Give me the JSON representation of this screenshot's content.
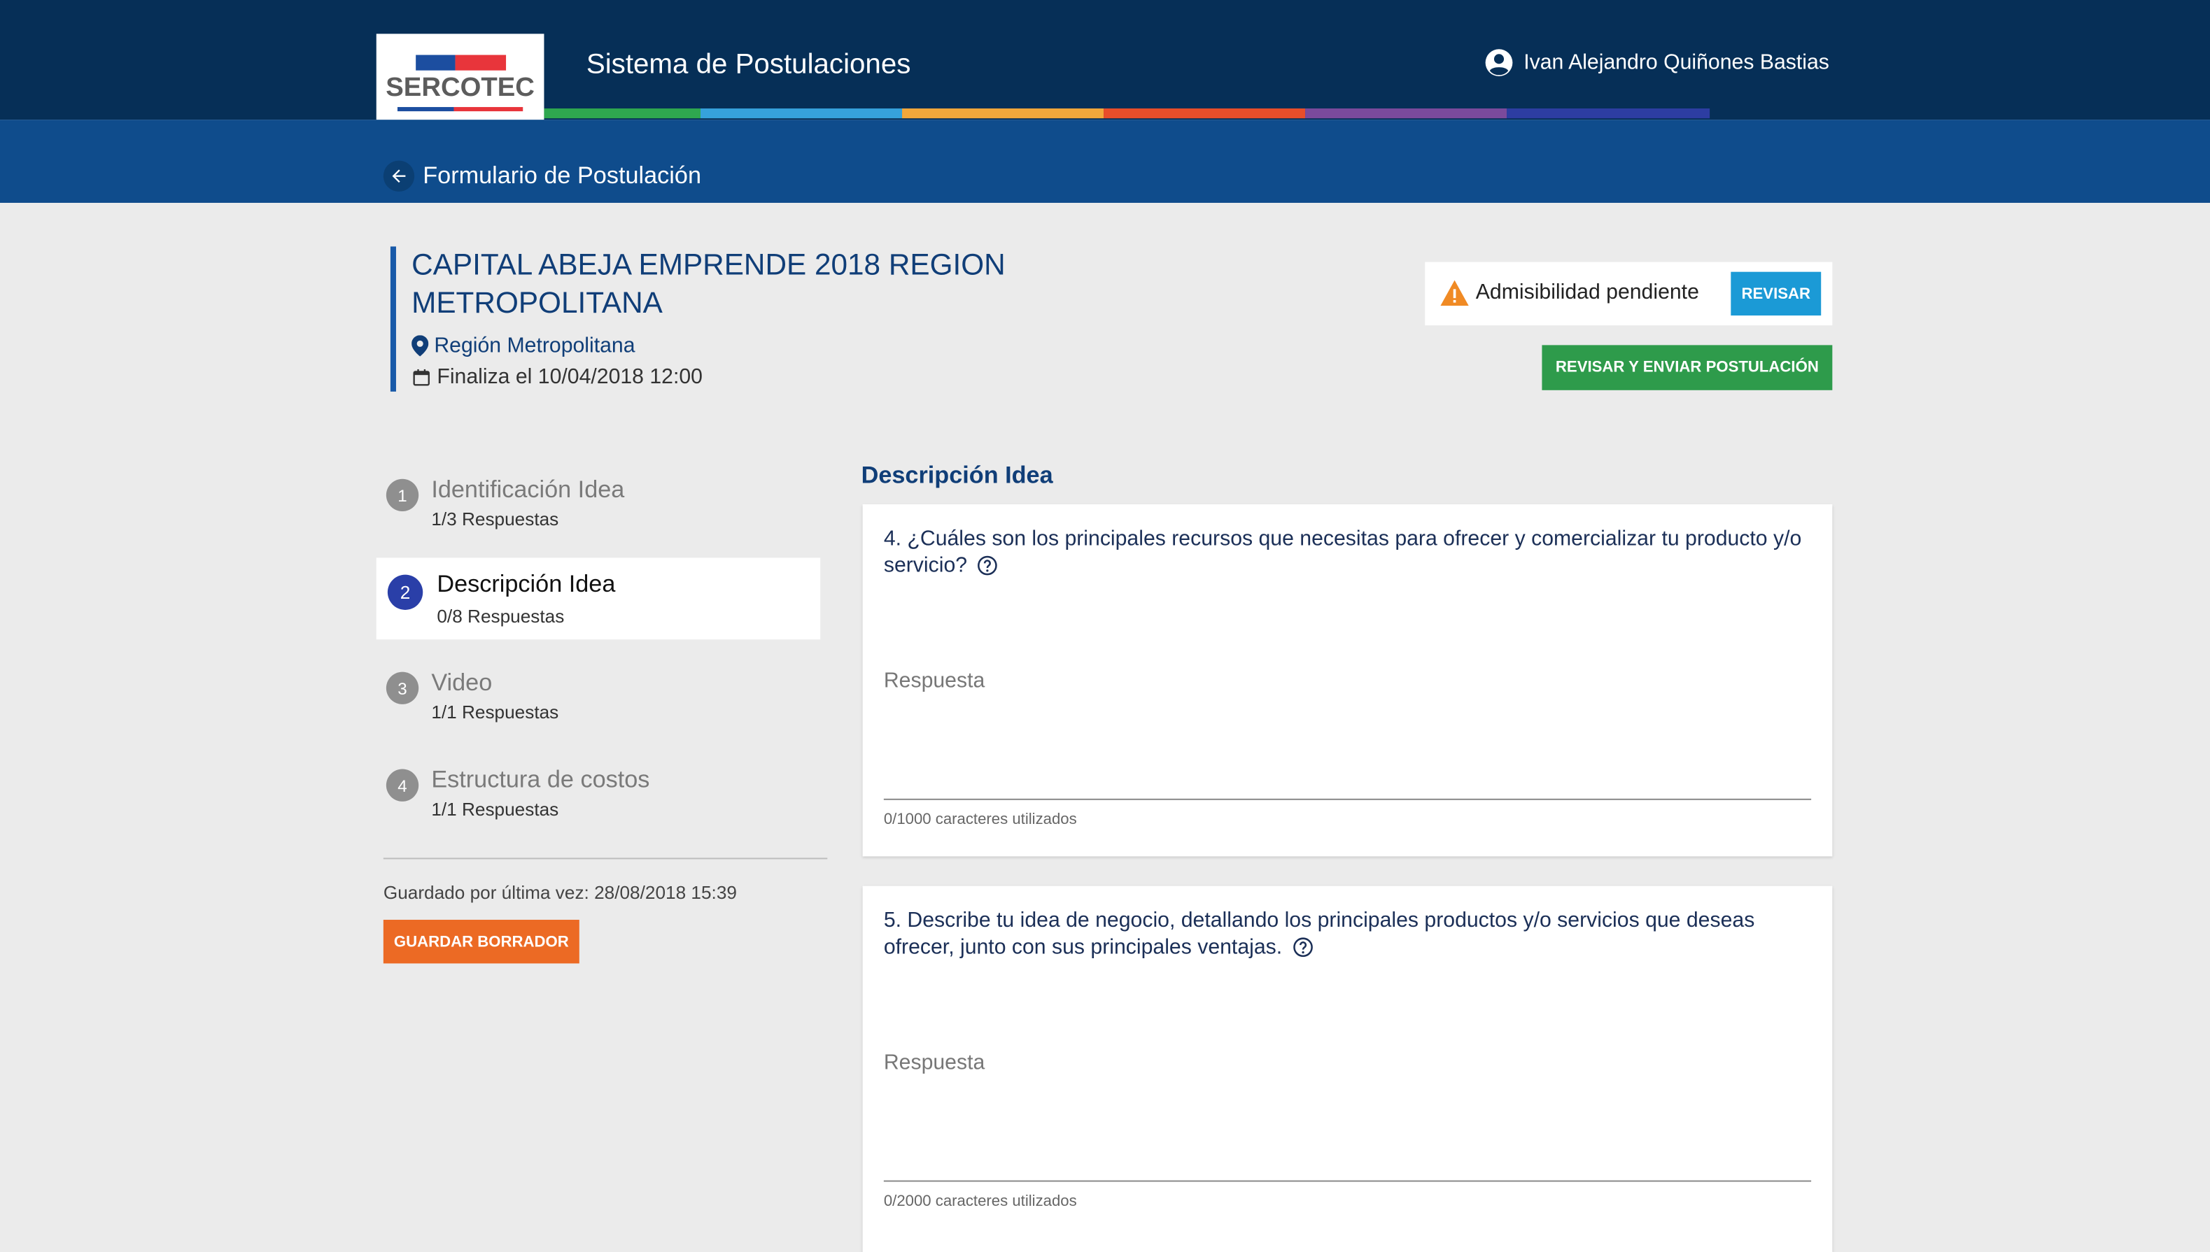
{
  "header": {
    "logo_text": "SERCOTEC",
    "app_title": "Sistema de Postulaciones",
    "user_name": "Ivan Alejandro Quiñones Bastias",
    "stripe_colors": [
      "#2fa84f",
      "#36a2dc",
      "#f2a83b",
      "#e84e2a",
      "#7b4a9c",
      "#2d3da2"
    ]
  },
  "subheader": {
    "title": "Formulario de Postulación"
  },
  "call": {
    "title": "CAPITAL ABEJA EMPRENDE 2018 REGION METROPOLITANA",
    "region": "Región Metropolitana",
    "deadline": "Finaliza el 10/04/2018 12:00"
  },
  "admissibility": {
    "status": "Admisibilidad pendiente",
    "review_label": "REVISAR"
  },
  "submit_label": "REVISAR Y ENVIAR POSTULACIÓN",
  "steps": [
    {
      "num": "1",
      "title": "Identificación Idea",
      "sub": "1/3 Respuestas",
      "active": false
    },
    {
      "num": "2",
      "title": "Descripción Idea",
      "sub": "0/8 Respuestas",
      "active": true
    },
    {
      "num": "3",
      "title": "Video",
      "sub": "1/1 Respuestas",
      "active": false
    },
    {
      "num": "4",
      "title": "Estructura de costos",
      "sub": "1/1 Respuestas",
      "active": false
    }
  ],
  "saved": "Guardado por última vez: 28/08/2018 15:39",
  "draft_label": "GUARDAR BORRADOR",
  "section_title": "Descripción Idea",
  "questions": [
    {
      "text": "4. ¿Cuáles son los principales recursos que necesitas para ofrecer y comercializar tu producto y/o servicio?",
      "placeholder": "Respuesta",
      "value": "",
      "counter": "0/1000 caracteres utilizados"
    },
    {
      "text": "5. Describe tu idea de negocio, detallando los principales productos y/o servicios que deseas ofrecer, junto con sus principales ventajas.",
      "placeholder": "Respuesta",
      "value": "",
      "counter": "0/2000 caracteres utilizados"
    }
  ],
  "colors": {
    "topbar": "#062f57",
    "subbar": "#0f4c8c",
    "accent_blue": "#103e78",
    "review_button": "#1b9ad6",
    "submit_button": "#2e9b4b",
    "draft_button": "#ec6a24",
    "active_step": "#2a3fa8",
    "warning": "#f08a24"
  }
}
